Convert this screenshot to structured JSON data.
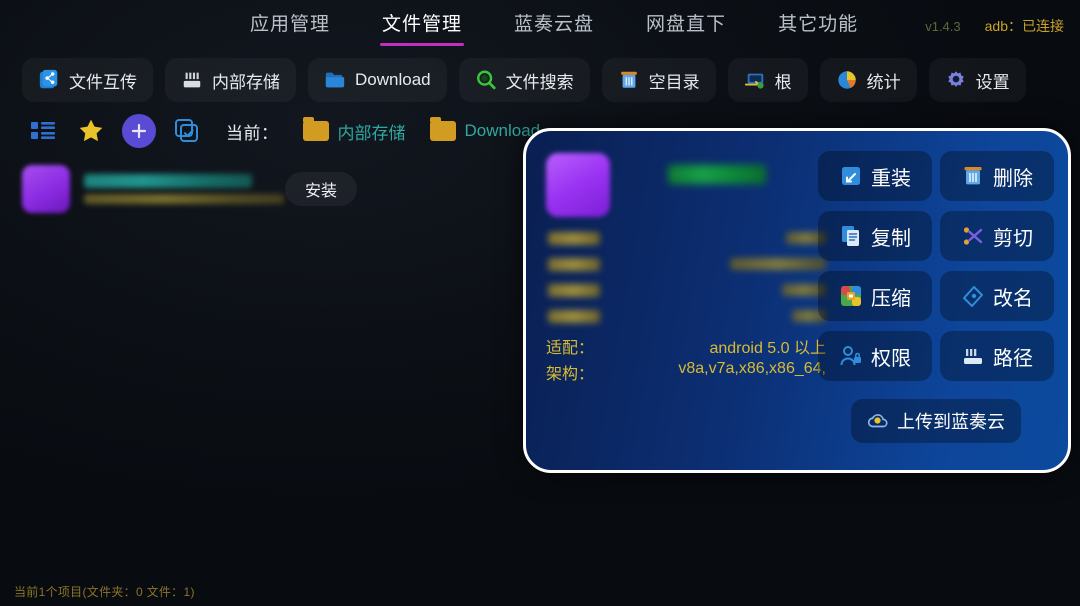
{
  "topnav": {
    "tabs": [
      {
        "label": "应用管理",
        "active": false
      },
      {
        "label": "文件管理",
        "active": true
      },
      {
        "label": "蓝奏云盘",
        "active": false
      },
      {
        "label": "网盘直下",
        "active": false
      },
      {
        "label": "其它功能",
        "active": false
      }
    ],
    "version": "v1.4.3",
    "adb_status": "adb：已连接",
    "active_underline_color": "#c22ec2"
  },
  "toolbar_primary": [
    {
      "label": "文件互传",
      "icon": "share-icon"
    },
    {
      "label": "内部存储",
      "icon": "internal-storage-icon"
    },
    {
      "label": "Download",
      "icon": "folder-icon"
    },
    {
      "label": "文件搜索",
      "icon": "search-icon"
    },
    {
      "label": "空目录",
      "icon": "trash-icon"
    },
    {
      "label": "根",
      "icon": "root-icon"
    },
    {
      "label": "统计",
      "icon": "pie-chart-icon"
    },
    {
      "label": "设置",
      "icon": "gear-icon"
    }
  ],
  "toolbar_secondary": {
    "icons": [
      {
        "name": "list-view-icon"
      },
      {
        "name": "star-icon"
      },
      {
        "name": "add-icon"
      },
      {
        "name": "multi-select-icon"
      }
    ],
    "current_label": "当前：",
    "breadcrumbs": [
      {
        "label": "内部存储"
      },
      {
        "label": "Download"
      }
    ]
  },
  "file_list": [
    {
      "name_redacted": true,
      "meta_redacted": true,
      "action_label": "安装",
      "icon_color": "#9a33f2"
    }
  ],
  "status_bar": {
    "text": "当前1个项目(文件夹：0  文件：1)"
  },
  "dialog": {
    "app_name_redacted": true,
    "app_icon_color": "#9a33f2",
    "info_rows": [
      {
        "key_redacted": true,
        "value_redacted": true,
        "key_width": 52,
        "value_width": 40
      },
      {
        "key_redacted": true,
        "value_redacted": true,
        "key_width": 52,
        "value_width": 96
      },
      {
        "key_redacted": true,
        "value_redacted": true,
        "key_width": 52,
        "value_width": 44
      },
      {
        "key_redacted": true,
        "value_redacted": true,
        "key_width": 52,
        "value_width": 34
      },
      {
        "key": "适配：",
        "value": "android 5.0 以上"
      },
      {
        "key": "架构：",
        "value": "v8a,v7a,x86,x86_64,"
      }
    ],
    "actions": [
      {
        "label": "重装",
        "icon": "reinstall-icon"
      },
      {
        "label": "删除",
        "icon": "trash-icon"
      },
      {
        "label": "复制",
        "icon": "copy-icon"
      },
      {
        "label": "剪切",
        "icon": "scissors-icon"
      },
      {
        "label": "压缩",
        "icon": "archive-icon"
      },
      {
        "label": "改名",
        "icon": "rename-pen-icon"
      },
      {
        "label": "权限",
        "icon": "permission-user-lock-icon"
      },
      {
        "label": "路径",
        "icon": "path-icon"
      }
    ],
    "upload": {
      "label": "上传到蓝奏云",
      "icon": "cloud-upload-icon"
    },
    "border_color": "#ffffff",
    "gradient_from": "#0a1f52",
    "gradient_to": "#0c4a9e"
  }
}
